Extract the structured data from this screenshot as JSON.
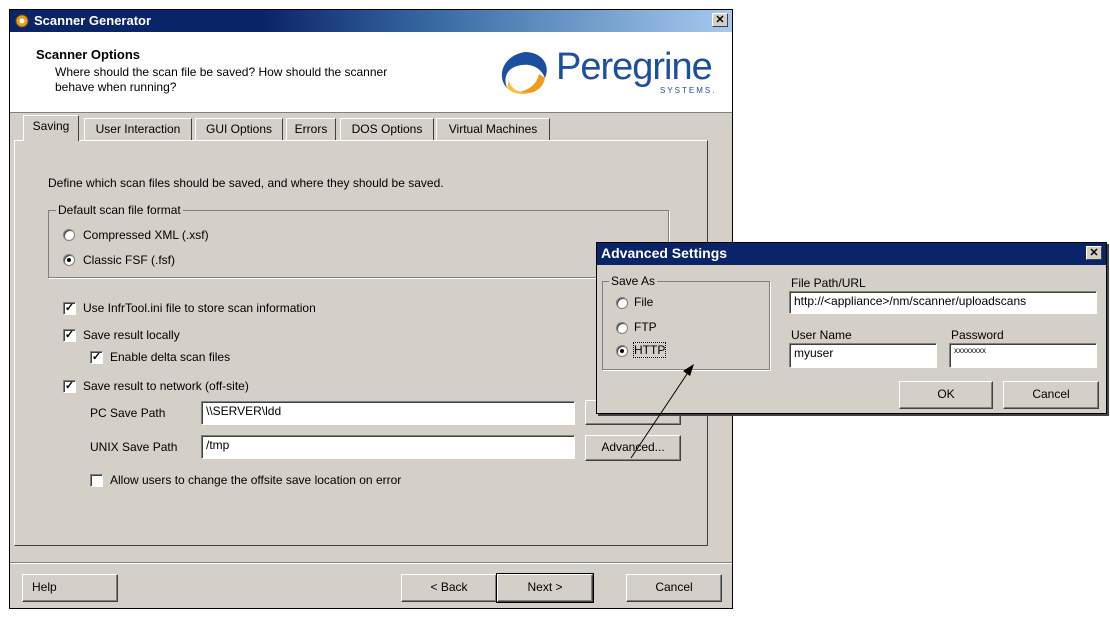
{
  "main_window": {
    "title": "Scanner Generator",
    "header": {
      "title": "Scanner Options",
      "subtitle_line1": "Where should the scan file be saved?  How should the scanner",
      "subtitle_line2": "behave when running?",
      "logo_text": "Peregrine",
      "logo_subtext": "SYSTEMS."
    },
    "tabs": [
      {
        "label": "Saving",
        "active": true
      },
      {
        "label": "User Interaction",
        "active": false
      },
      {
        "label": "GUI Options",
        "active": false
      },
      {
        "label": "Errors",
        "active": false
      },
      {
        "label": "DOS Options",
        "active": false
      },
      {
        "label": "Virtual Machines",
        "active": false
      }
    ],
    "saving": {
      "description": "Define which scan files should be saved, and where they should be saved.",
      "format_group": {
        "title": "Default scan file format",
        "options": [
          {
            "label": "Compressed XML (.xsf)",
            "selected": false
          },
          {
            "label": "Classic FSF (.fsf)",
            "selected": true
          }
        ]
      },
      "checkboxes": [
        {
          "label": "Use InfrTool.ini file to store scan information",
          "checked": true
        },
        {
          "label": "Save result locally",
          "checked": true
        },
        {
          "label": "Enable delta scan files",
          "checked": true
        },
        {
          "label": "Save result to network (off-site)",
          "checked": true
        }
      ],
      "pc_save_path": {
        "label": "PC Save Path",
        "value": "\\\\SERVER\\ldd"
      },
      "unix_save_path": {
        "label": "UNIX Save Path",
        "value": "/tmp"
      },
      "advanced_button": "Advanced...",
      "allow_change": {
        "label": "Allow users to change the offsite save location on error",
        "checked": false
      }
    },
    "footer": {
      "help": "Help",
      "back": "< Back",
      "next": "Next >",
      "cancel": "Cancel"
    }
  },
  "advanced_dialog": {
    "title": "Advanced Settings",
    "save_as": {
      "title": "Save As",
      "options": [
        {
          "label": "File",
          "selected": false
        },
        {
          "label": "FTP",
          "selected": false
        },
        {
          "label": "HTTP",
          "selected": true
        }
      ]
    },
    "file_path": {
      "label": "File Path/URL",
      "value": "http://<appliance>/nm/scanner/uploadscans"
    },
    "user_name": {
      "label": "User Name",
      "value": "myuser"
    },
    "password": {
      "label": "Password",
      "value": "xxxxxxxx"
    },
    "ok": "OK",
    "cancel": "Cancel"
  },
  "colors": {
    "titlebar_active": "#0a246a",
    "face": "#d4d0c8",
    "logo_blue": "#1c4fa0"
  }
}
